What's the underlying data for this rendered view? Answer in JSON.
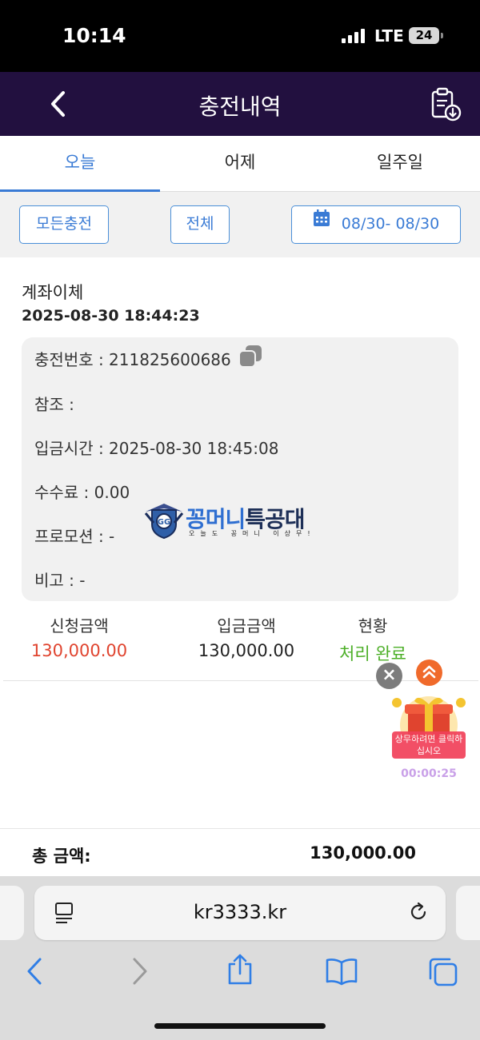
{
  "status_bar": {
    "time": "10:14",
    "network": "LTE",
    "battery": "24"
  },
  "header": {
    "title": "충전내역",
    "back_icon": "chevron-left-icon",
    "download_icon": "clipboard-download-icon"
  },
  "tabs": [
    {
      "label": "오늘",
      "active": true
    },
    {
      "label": "어제",
      "active": false
    },
    {
      "label": "일주일",
      "active": false
    }
  ],
  "filters": {
    "type": "모든충전",
    "status": "전체",
    "date_range": "08/30- 08/30"
  },
  "record": {
    "method": "계좌이체",
    "datetime": "2025-08-30 18:44:23",
    "details": {
      "charge_no": "충전번호 : 211825600686",
      "reference": "참조 :",
      "deposit_time": "입금시간 : 2025-08-30 18:45:08",
      "fee": "수수료 : 0.00",
      "promotion": "프로모션 : -",
      "note": "비고 : -"
    },
    "summary": {
      "requested_label": "신청금액",
      "requested_value": "130,000.00",
      "deposited_label": "입금금액",
      "deposited_value": "130,000.00",
      "status_label": "현황",
      "status_value": "처리 완료"
    }
  },
  "watermark": {
    "brand_a": "꽁머니",
    "brand_b": "특공대",
    "slogan": "오늘도 꽁머니 이상무!"
  },
  "floating": {
    "promo_text": "상무하려면 클릭하십시오",
    "timer": "00:00:25"
  },
  "total": {
    "label": "총 금액:",
    "amount": "130,000.00"
  },
  "browser": {
    "url": "kr3333.kr"
  },
  "colors": {
    "header_bg": "#22103f",
    "accent": "#3a7bd5",
    "requested": "#e0442f",
    "status_done": "#4caf27"
  }
}
